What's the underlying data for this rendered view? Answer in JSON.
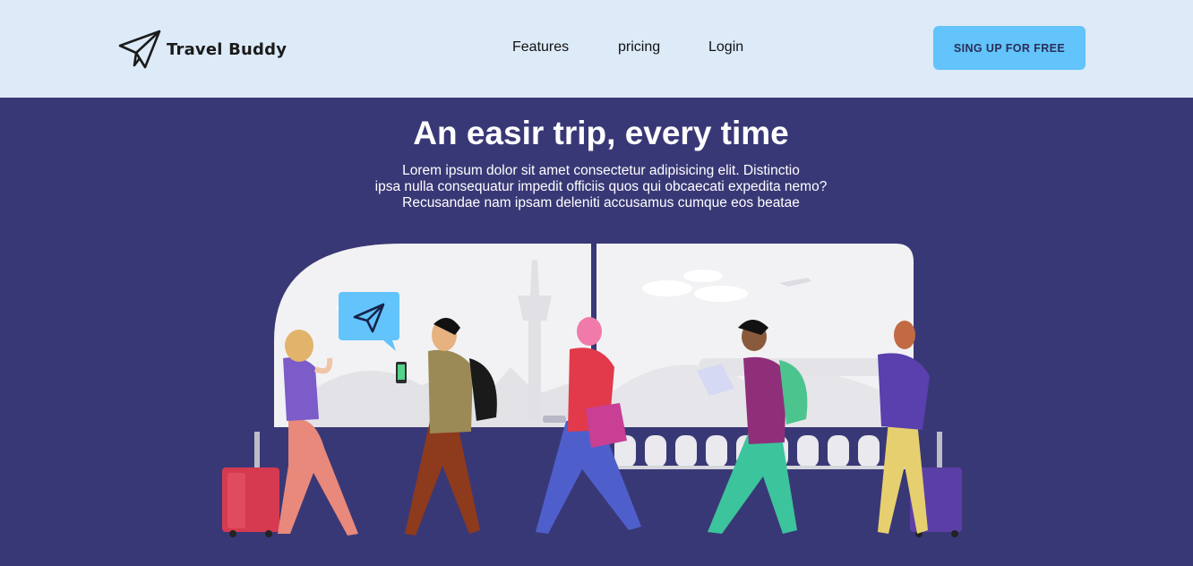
{
  "brand": {
    "name": "Travel Buddy",
    "logo_icon": "paper-plane-icon"
  },
  "nav": {
    "features": "Features",
    "pricing": "pricing",
    "login": "Login"
  },
  "cta": {
    "label": "SING UP FOR FREE"
  },
  "hero": {
    "title": "An easir trip, every time",
    "lines": [
      "Lorem ipsum dolor sit amet consectetur adipisicing elit. Distinctio",
      "ipsa nulla consequatur impedit officiis quos qui obcaecati expedita nemo?",
      "Recusandae nam ipsam deleniti accusamus cumque eos beatae"
    ]
  },
  "illustration": {
    "bubble_icon": "paper-plane-icon"
  },
  "colors": {
    "header_bg": "#ddeaf8",
    "hero_bg": "#393876",
    "cta_bg": "#63c3fb"
  }
}
